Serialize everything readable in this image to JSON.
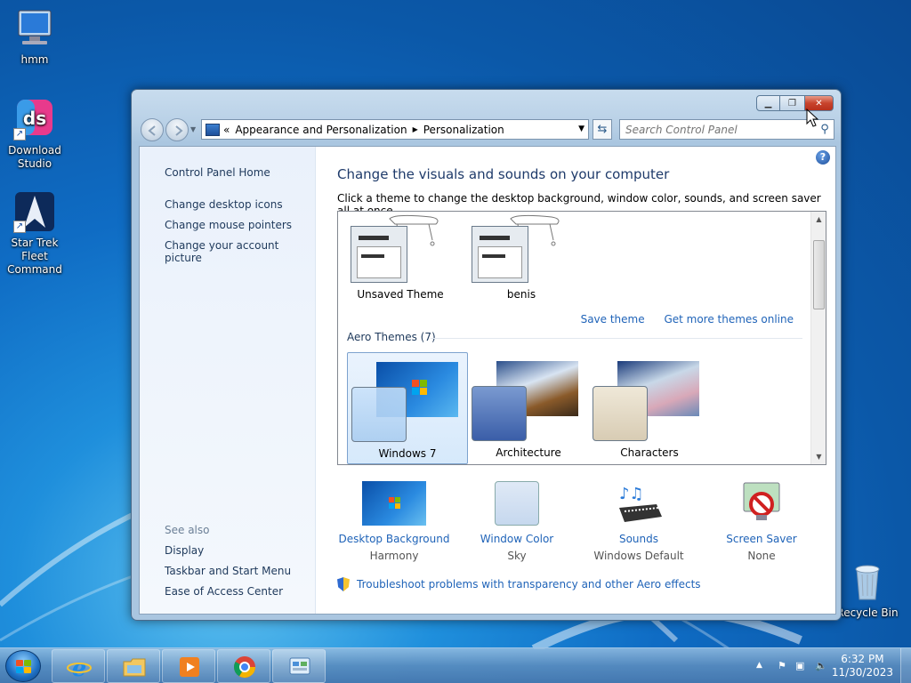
{
  "desktop": {
    "icons": [
      {
        "label": "hmm"
      },
      {
        "label": "Download Studio"
      },
      {
        "label": "Star Trek Fleet Command"
      },
      {
        "label": "Recycle Bin"
      }
    ]
  },
  "window": {
    "address": {
      "crumbs": [
        "Appearance and Personalization",
        "Personalization"
      ],
      "prefix": "«"
    },
    "search": {
      "placeholder": "Search Control Panel"
    },
    "left_pane": {
      "home": "Control Panel Home",
      "links": [
        "Change desktop icons",
        "Change mouse pointers",
        "Change your account picture"
      ],
      "see_also_label": "See also",
      "see_also": [
        "Display",
        "Taskbar and Start Menu",
        "Ease of Access Center"
      ]
    },
    "main": {
      "title": "Change the visuals and sounds on your computer",
      "subtitle": "Click a theme to change the desktop background, window color, sounds, and screen saver all at once.",
      "my_themes": [
        {
          "label": "Unsaved Theme"
        },
        {
          "label": "benis"
        }
      ],
      "save_theme": "Save theme",
      "get_more": "Get more themes online",
      "aero_group": "Aero Themes (7)",
      "aero_themes": [
        {
          "label": "Windows 7",
          "selected": true
        },
        {
          "label": "Architecture",
          "selected": false
        },
        {
          "label": "Characters",
          "selected": false
        }
      ],
      "bottom_items": [
        {
          "label": "Desktop Background",
          "value": "Harmony"
        },
        {
          "label": "Window Color",
          "value": "Sky"
        },
        {
          "label": "Sounds",
          "value": "Windows Default"
        },
        {
          "label": "Screen Saver",
          "value": "None"
        }
      ],
      "troubleshoot": "Troubleshoot problems with transparency and other Aero effects"
    }
  },
  "taskbar": {
    "apps": [
      "internet-explorer",
      "file-explorer",
      "media-player",
      "chrome",
      "control-panel"
    ],
    "clock": {
      "time": "6:32 PM",
      "date": "11/30/2023"
    }
  },
  "colors": {
    "link": "#1f63b8",
    "title": "#1e3a6a",
    "close_button": "#c8432c"
  }
}
